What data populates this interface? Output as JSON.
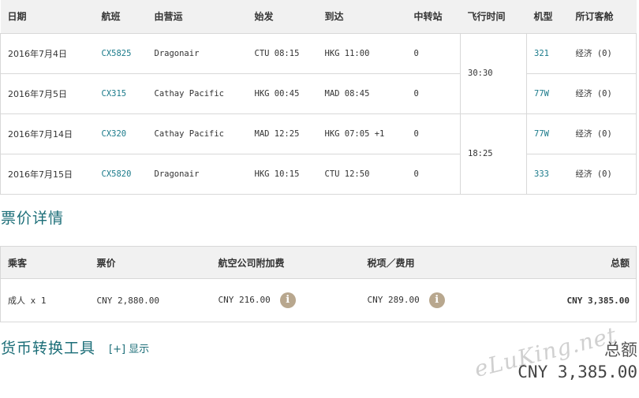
{
  "flights": {
    "headers": {
      "date": "日期",
      "flight": "航班",
      "operator": "由营运",
      "depart": "始发",
      "arrive": "到达",
      "stops": "中转站",
      "flight_time": "飞行时间",
      "aircraft": "机型",
      "cabin": "所订客舱"
    },
    "rows": [
      {
        "date": "2016年7月4日",
        "flight": "CX5825",
        "operator": "Dragonair",
        "depart": "CTU 08:15",
        "arrive": "HKG 11:00",
        "stops": "0",
        "aircraft": "321",
        "cabin": "经济 (0)"
      },
      {
        "date": "2016年7月5日",
        "flight": "CX315",
        "operator": "Cathay Pacific",
        "depart": "HKG 00:45",
        "arrive": "MAD 08:45",
        "stops": "0",
        "aircraft": "77W",
        "cabin": "经济 (0)"
      },
      {
        "date": "2016年7月14日",
        "flight": "CX320",
        "operator": "Cathay Pacific",
        "depart": "MAD 12:25",
        "arrive": "HKG 07:05 +1",
        "stops": "0",
        "aircraft": "77W",
        "cabin": "经济 (0)"
      },
      {
        "date": "2016年7月15日",
        "flight": "CX5820",
        "operator": "Dragonair",
        "depart": "HKG 10:15",
        "arrive": "CTU 12:50",
        "stops": "0",
        "aircraft": "333",
        "cabin": "经济 (0)"
      }
    ],
    "flight_times": [
      "30:30",
      "18:25"
    ]
  },
  "fare_details": {
    "title": "票价详情",
    "headers": {
      "passenger": "乘客",
      "fare": "票价",
      "surcharge": "航空公司附加费",
      "taxes": "税项／费用",
      "total": "总额"
    },
    "row": {
      "passenger": "成人 x 1",
      "fare": "CNY 2,880.00",
      "surcharge": "CNY 216.00",
      "taxes": "CNY 289.00",
      "total": "CNY 3,385.00"
    }
  },
  "currency_tool": {
    "title": "货币转换工具",
    "toggle_label": "[+] 显示",
    "total_label": "总额",
    "total_value": "CNY 3,385.00"
  },
  "watermark": "eLuKing.net",
  "colors": {
    "accent": "#1c6e78",
    "link": "#1a7a8a",
    "header_bg": "#f1f1f1",
    "border": "#d8d8d8",
    "info_icon": "#b8a78e"
  }
}
